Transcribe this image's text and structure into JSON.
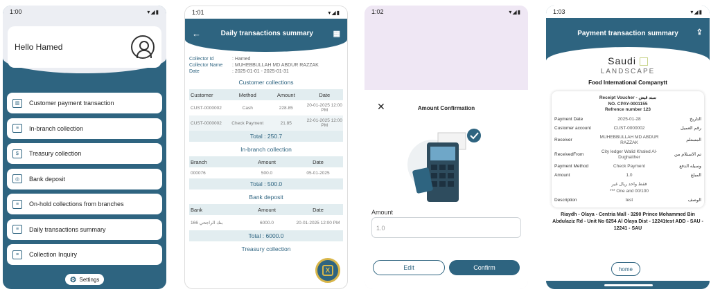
{
  "p1": {
    "time": "1:00",
    "greeting": "Hello Hamed",
    "menu": [
      {
        "label": "Customer payment transaction",
        "icon": "bank-icon"
      },
      {
        "label": "In-branch collection",
        "icon": "document-icon"
      },
      {
        "label": "Treasury collection",
        "icon": "cash-icon"
      },
      {
        "label": "Bank deposit",
        "icon": "deposit-icon"
      },
      {
        "label": "On-hold collections from branches",
        "icon": "document-icon"
      },
      {
        "label": "Daily transactions summary",
        "icon": "document-icon"
      },
      {
        "label": "Collection Inquiry",
        "icon": "document-icon"
      }
    ],
    "settings": "Settings"
  },
  "p2": {
    "time": "1:01",
    "title": "Daily transactions summary",
    "meta": [
      [
        "Collector Id",
        ": Hamed"
      ],
      [
        "Collector Name",
        ": MUHEBBULLAH MD ABDUR  RAZZAK"
      ],
      [
        "Date",
        ": 2025-01-01 - 2025-01-31"
      ]
    ],
    "s1": {
      "title": "Customer collections",
      "head": [
        "Customer",
        "Method",
        "Amount",
        "Date"
      ],
      "rows": [
        [
          "CUST-0000002",
          "Cash",
          "228.85",
          "20-01-2025 12:00 PM"
        ],
        [
          "CUST-0000002",
          "Check Payment",
          "21.85",
          "22-01-2025 12:00 PM"
        ]
      ],
      "total": "Total  :  250.7"
    },
    "s2": {
      "title": "In-branch collection",
      "head": [
        "Branch",
        "Amount",
        "Date"
      ],
      "rows": [
        [
          "000076",
          "500.0",
          "05-01-2025"
        ]
      ],
      "total": "Total  :  500.0"
    },
    "s3": {
      "title": "Bank deposit",
      "head": [
        "Bank",
        "Amount",
        "Date"
      ],
      "rows": [
        [
          "بنك الراجحي 166",
          "6000.0",
          "20-01-2025 12:00 PM"
        ]
      ],
      "total": "Total  :  6000.0"
    },
    "s4": {
      "title": "Treasury collection"
    }
  },
  "p3": {
    "time": "1:02",
    "title": "Amount Confirmation",
    "amount_label": "Amount",
    "amount_value": "1.0",
    "edit": "Edit",
    "confirm": "Confirm"
  },
  "p4": {
    "time": "1:03",
    "title": "Payment transaction summary",
    "logo1": "Saudi",
    "logo2": "LANDSCAPE",
    "company": "Food International Companytt",
    "voucher": [
      "Receipt Voucher - سند قبض",
      "NO. CPAY-0001155",
      "Refrence number 123"
    ],
    "rows": [
      [
        "Payment Date",
        "2025-01-28",
        "التاريخ"
      ],
      [
        "Customer account",
        "CUST-0000002",
        "رقم العميل"
      ],
      [
        "Receiver",
        "MUHEBBULLAH MD ABDUR  RAZZAK",
        "المستلم"
      ],
      [
        "ReceivedFrom",
        "City ledger Walid Khaled Al-Dughaither",
        "تم الاستلام من"
      ],
      [
        "Payment Method",
        "Check Payment",
        "وسيله الدفع"
      ],
      [
        "Amount",
        "1.0",
        "المبلغ"
      ],
      [
        "",
        "فقط  واحد ريال غير",
        ""
      ],
      [
        "",
        "*** One and 00/100",
        ""
      ],
      [
        "Description",
        "test",
        "الوصف"
      ]
    ],
    "address": "Riaydh - Olaya - Centria Mall - 3290 Prince Mohammed Bin Abdulaziz Rd - Unit No 6254 Al Olaya Dist - 12241test ADD - SAU - 12241 - SAU",
    "home": "home"
  }
}
